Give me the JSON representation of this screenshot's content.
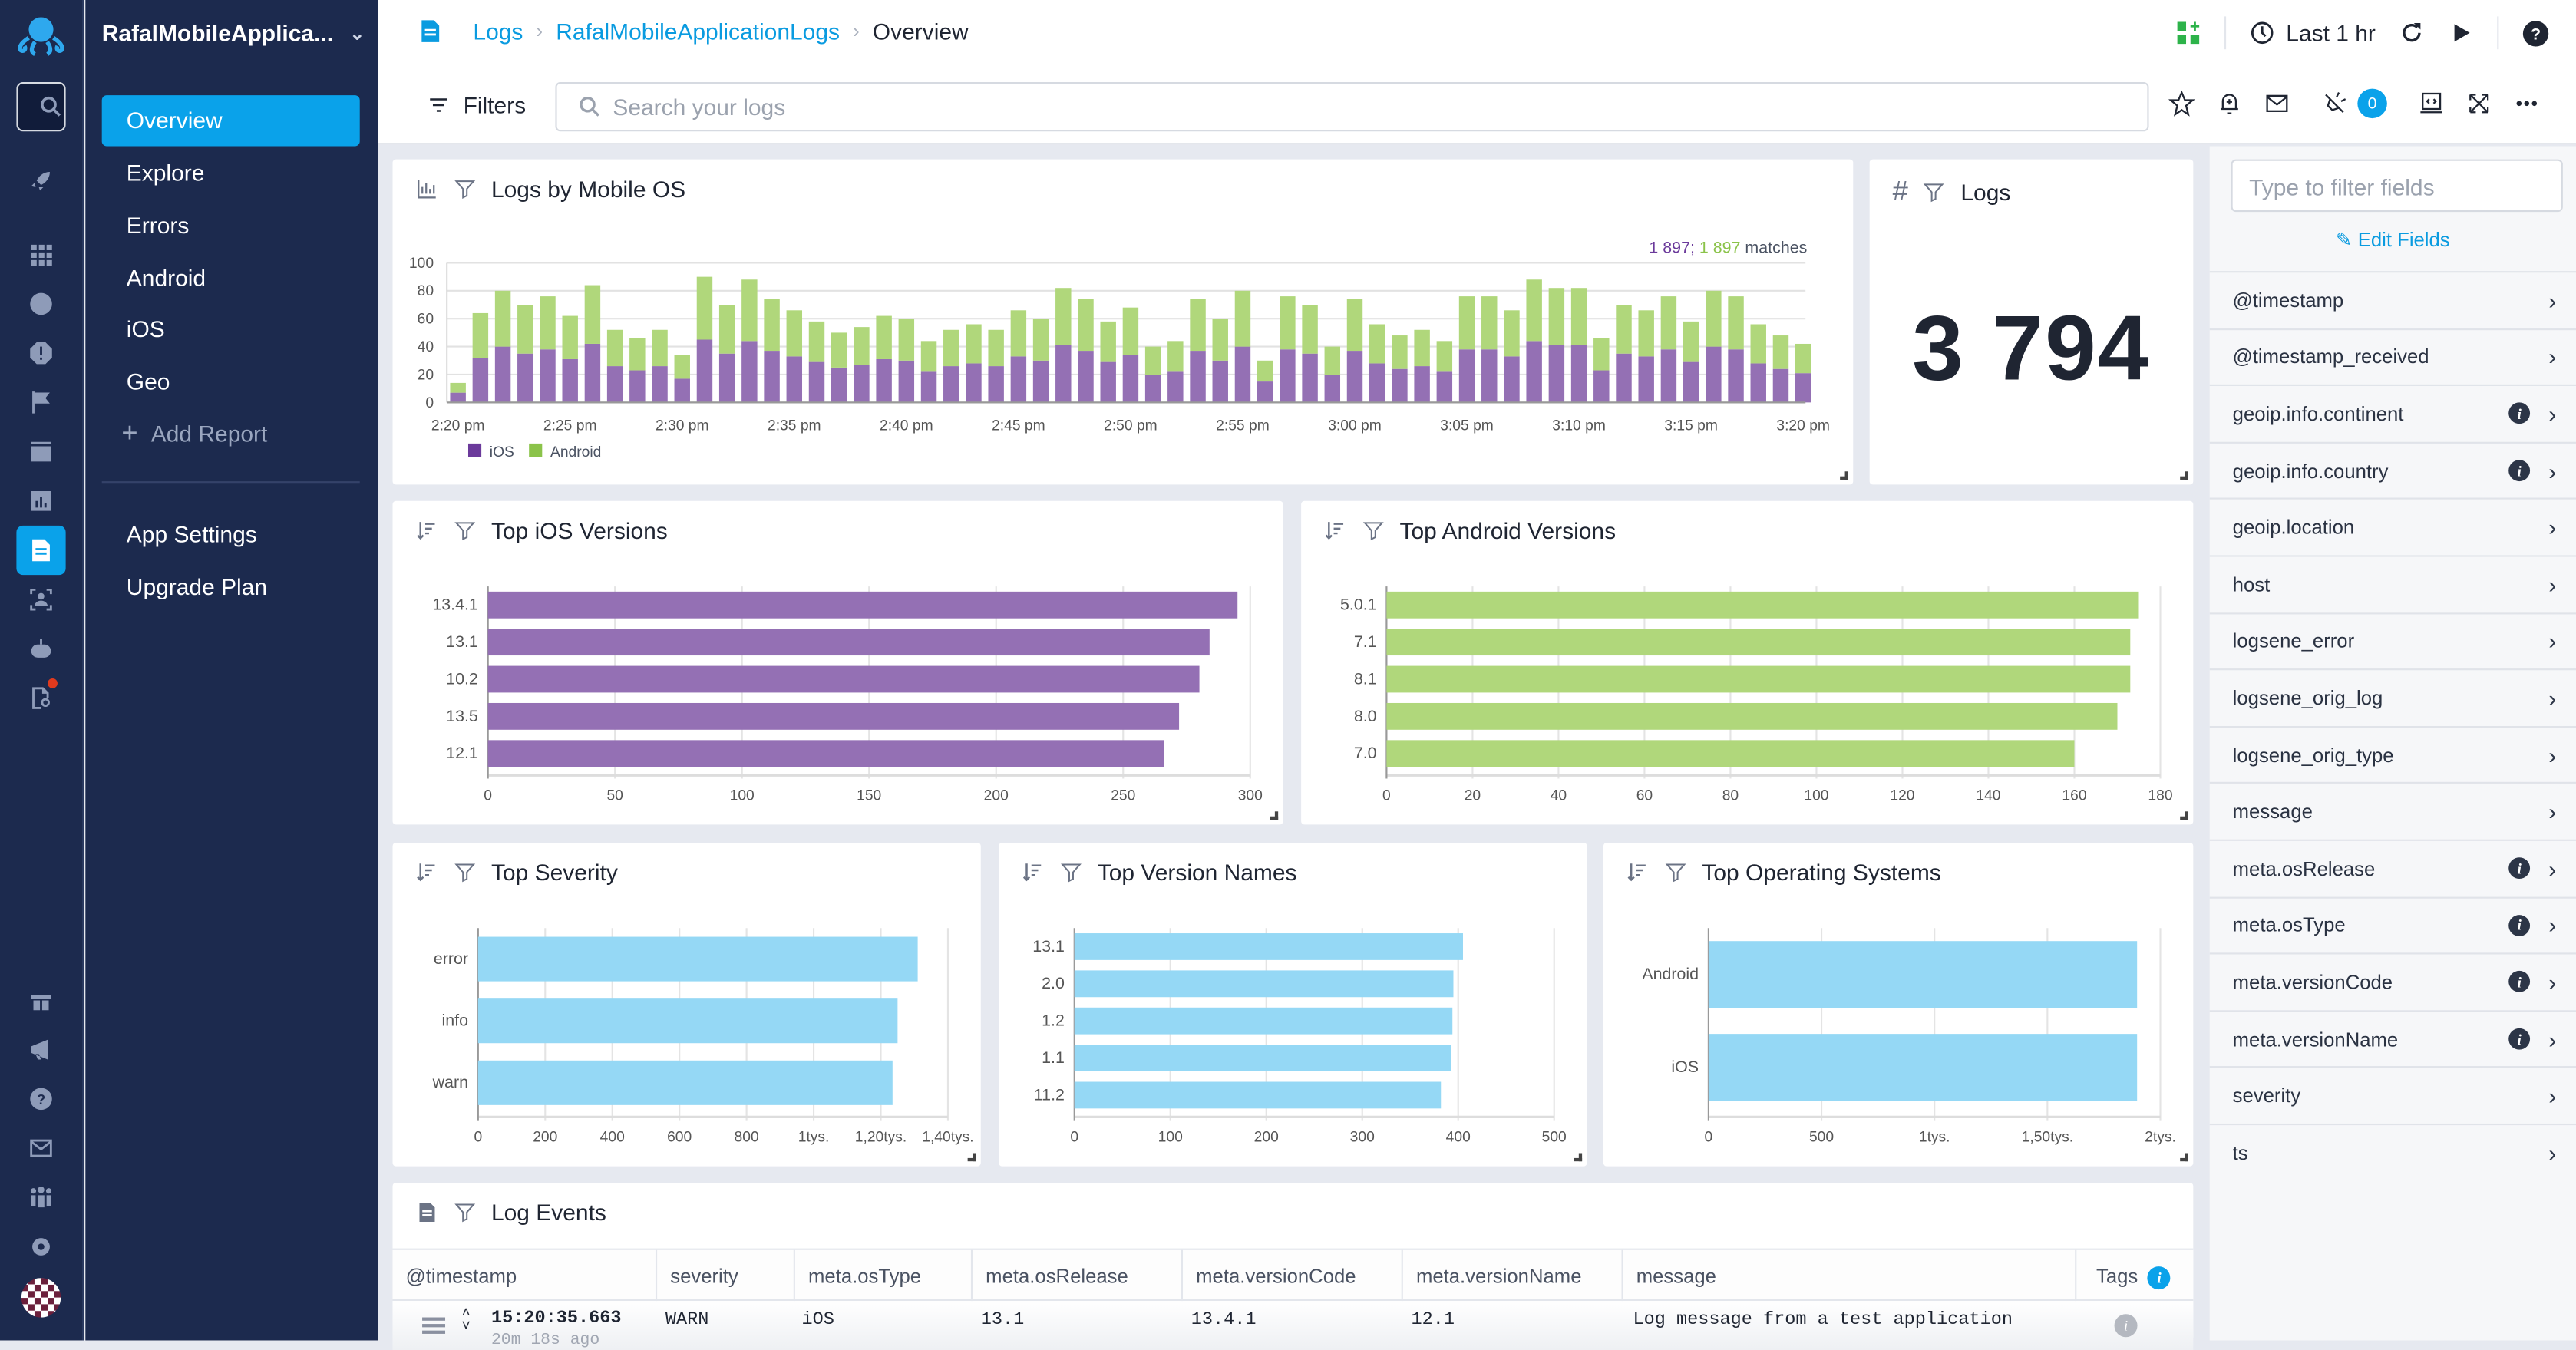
{
  "app": {
    "name": "RafalMobileApplica...",
    "dropdown_icon": "chevron-down-icon"
  },
  "rail": {
    "icons": [
      "logo-octopus-icon",
      "search-icon",
      "rocket-icon",
      "apps-grid-icon",
      "dashboard-gauge-icon",
      "alert-icon",
      "flag-icon",
      "archive-icon",
      "bar-chart-icon",
      "logs-document-icon",
      "user-focus-icon",
      "robot-icon",
      "log-search-icon",
      "gift-icon",
      "megaphone-icon",
      "help-icon",
      "mail-icon",
      "team-icon",
      "settings-gear-icon"
    ],
    "active": "logs-document-icon"
  },
  "nav": {
    "items": [
      {
        "label": "Overview",
        "active": true
      },
      {
        "label": "Explore"
      },
      {
        "label": "Errors"
      },
      {
        "label": "Android"
      },
      {
        "label": "iOS"
      },
      {
        "label": "Geo"
      }
    ],
    "add_report": "Add Report",
    "bottom_items": [
      {
        "label": "App Settings"
      },
      {
        "label": "Upgrade Plan"
      }
    ]
  },
  "header": {
    "breadcrumb": [
      "Logs",
      "RafalMobileApplicationLogs",
      "Overview"
    ],
    "time_range": "Last 1 hr",
    "filters_label": "Filters",
    "search_placeholder": "Search your logs",
    "notification_count": "0"
  },
  "panels": {
    "logs_by_os": {
      "title": "Logs by Mobile OS",
      "matches_ios": "1 897",
      "matches_android": "1 897",
      "matches_suffix": "matches"
    },
    "logs_count": {
      "title": "Logs",
      "value": "3 794"
    },
    "ios_versions": {
      "title": "Top iOS Versions"
    },
    "android_versions": {
      "title": "Top Android Versions"
    },
    "severity": {
      "title": "Top Severity"
    },
    "version_names": {
      "title": "Top Version Names"
    },
    "operating_systems": {
      "title": "Top Operating Systems"
    },
    "log_events": {
      "title": "Log Events"
    }
  },
  "log_table": {
    "columns": [
      "@timestamp",
      "severity",
      "meta.osType",
      "meta.osRelease",
      "meta.versionCode",
      "meta.versionName",
      "message",
      "Tags"
    ],
    "rows": [
      {
        "time": "15:20:35.663",
        "ago": "20m 18s ago",
        "severity": "WARN",
        "osType": "iOS",
        "osRelease": "13.1",
        "versionCode": "13.4.1",
        "versionName": "12.1",
        "message": "Log message from a test application"
      }
    ]
  },
  "fields": {
    "filter_placeholder": "Type to filter fields",
    "edit_label": "Edit Fields",
    "items": [
      {
        "name": "@timestamp",
        "info": false
      },
      {
        "name": "@timestamp_received",
        "info": false
      },
      {
        "name": "geoip.info.continent",
        "info": true
      },
      {
        "name": "geoip.info.country",
        "info": true
      },
      {
        "name": "geoip.location",
        "info": false
      },
      {
        "name": "host",
        "info": false
      },
      {
        "name": "logsene_error",
        "info": false
      },
      {
        "name": "logsene_orig_log",
        "info": false
      },
      {
        "name": "logsene_orig_type",
        "info": false
      },
      {
        "name": "message",
        "info": false
      },
      {
        "name": "meta.osRelease",
        "info": true
      },
      {
        "name": "meta.osType",
        "info": true
      },
      {
        "name": "meta.versionCode",
        "info": true
      },
      {
        "name": "meta.versionName",
        "info": true
      },
      {
        "name": "severity",
        "info": false
      },
      {
        "name": "ts",
        "info": false
      }
    ]
  },
  "colors": {
    "ios": "#9470b4",
    "android": "#b0d77b",
    "bar_blue": "#95d8f5",
    "accent": "#0aa2ea",
    "sidebar": "#1c2a4e"
  },
  "chart_data": [
    {
      "type": "bar",
      "stacked": true,
      "title": "Logs by Mobile OS",
      "x": [
        "2:20 pm",
        "",
        "",
        "",
        "",
        "2:25 pm",
        "",
        "",
        "",
        "",
        "2:30 pm",
        "",
        "",
        "",
        "",
        "2:35 pm",
        "",
        "",
        "",
        "",
        "2:40 pm",
        "",
        "",
        "",
        "",
        "2:45 pm",
        "",
        "",
        "",
        "",
        "2:50 pm",
        "",
        "",
        "",
        "",
        "2:55 pm",
        "",
        "",
        "",
        "",
        "3:00 pm",
        "",
        "",
        "",
        "",
        "3:05 pm",
        "",
        "",
        "",
        "",
        "3:10 pm",
        "",
        "",
        "",
        "",
        "3:15 pm",
        "",
        "",
        "",
        "",
        "3:20 pm"
      ],
      "xticks": [
        "2:20 pm",
        "2:25 pm",
        "2:30 pm",
        "2:35 pm",
        "2:40 pm",
        "2:45 pm",
        "2:50 pm",
        "2:55 pm",
        "3:00 pm",
        "3:05 pm",
        "3:10 pm",
        "3:15 pm",
        "3:20 pm"
      ],
      "yticks": [
        0,
        20,
        40,
        60,
        80,
        100
      ],
      "ylim": [
        0,
        100
      ],
      "series": [
        {
          "name": "iOS",
          "values": [
            7,
            32,
            40,
            35,
            38,
            31,
            42,
            26,
            23,
            26,
            17,
            45,
            35,
            44,
            37,
            33,
            29,
            25,
            27,
            31,
            30,
            22,
            26,
            28,
            26,
            33,
            30,
            41,
            37,
            29,
            34,
            20,
            22,
            37,
            30,
            40,
            15,
            38,
            35,
            20,
            37,
            28,
            24,
            26,
            22,
            38,
            38,
            33,
            44,
            41,
            41,
            23,
            35,
            33,
            38,
            29,
            40,
            38,
            28,
            24,
            21
          ]
        },
        {
          "name": "Android",
          "values": [
            7,
            32,
            40,
            35,
            38,
            31,
            42,
            26,
            23,
            26,
            17,
            45,
            35,
            44,
            37,
            33,
            29,
            25,
            27,
            31,
            30,
            22,
            26,
            28,
            26,
            33,
            30,
            41,
            37,
            29,
            34,
            20,
            22,
            37,
            30,
            40,
            15,
            38,
            35,
            20,
            37,
            28,
            24,
            26,
            22,
            38,
            38,
            33,
            44,
            41,
            41,
            23,
            35,
            33,
            38,
            29,
            40,
            38,
            28,
            24,
            21
          ]
        }
      ],
      "legend": "bottom-left",
      "grid": true
    },
    {
      "type": "bar",
      "orientation": "horizontal",
      "title": "Top iOS Versions",
      "categories": [
        "13.4.1",
        "13.1",
        "10.2",
        "13.5",
        "12.1"
      ],
      "values": [
        295,
        284,
        280,
        272,
        266
      ],
      "xlim": [
        0,
        300
      ],
      "xticks": [
        "0",
        "50",
        "100",
        "150",
        "200",
        "250",
        "300"
      ]
    },
    {
      "type": "bar",
      "orientation": "horizontal",
      "title": "Top Android Versions",
      "categories": [
        "5.0.1",
        "7.1",
        "8.1",
        "8.0",
        "7.0"
      ],
      "values": [
        175,
        173,
        173,
        170,
        160
      ],
      "xlim": [
        0,
        180
      ],
      "xticks": [
        "0",
        "20",
        "40",
        "60",
        "80",
        "100",
        "120",
        "140",
        "160",
        "180"
      ]
    },
    {
      "type": "bar",
      "orientation": "horizontal",
      "title": "Top Severity",
      "categories": [
        "error",
        "info",
        "warn"
      ],
      "values": [
        1310,
        1250,
        1235
      ],
      "xlim": [
        0,
        1400
      ],
      "xticks": [
        "0",
        "200",
        "400",
        "600",
        "800",
        "1tys.",
        "1,20tys.",
        "1,40tys."
      ]
    },
    {
      "type": "bar",
      "orientation": "horizontal",
      "title": "Top Version Names",
      "categories": [
        "13.1",
        "2.0",
        "1.2",
        "1.1",
        "11.2"
      ],
      "values": [
        405,
        395,
        394,
        393,
        382
      ],
      "xlim": [
        0,
        500
      ],
      "xticks": [
        "0",
        "100",
        "200",
        "300",
        "400",
        "500"
      ]
    },
    {
      "type": "bar",
      "orientation": "horizontal",
      "title": "Top Operating Systems",
      "categories": [
        "Android",
        "iOS"
      ],
      "values": [
        1897,
        1897
      ],
      "xlim": [
        0,
        2000
      ],
      "xticks": [
        "0",
        "500",
        "1tys.",
        "1,50tys.",
        "2tys."
      ]
    }
  ]
}
